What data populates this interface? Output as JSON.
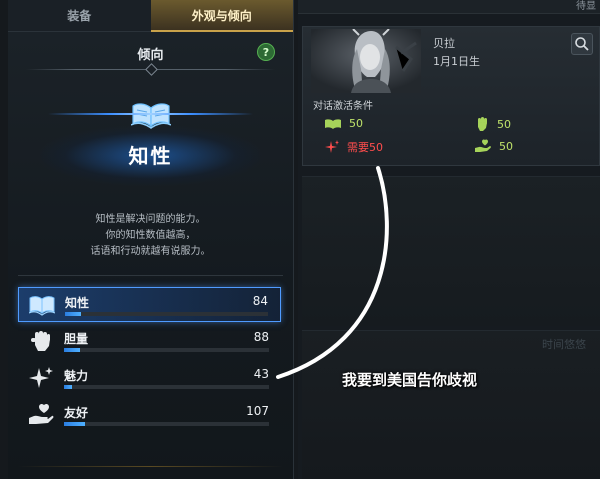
{
  "tabs": [
    {
      "label": "装备",
      "active": false
    },
    {
      "label": "外观与倾向",
      "active": true
    }
  ],
  "section": {
    "title": "倾向",
    "help_label": "?"
  },
  "hero": {
    "name": "知性",
    "icon": "open-book-icon",
    "description_lines": [
      "知性是解决问题的能力。",
      "你的知性数值越高，",
      "话语和行动就越有说服力。"
    ]
  },
  "stats": [
    {
      "label": "知性",
      "value": "84",
      "icon": "open-book-icon",
      "progress_percent": 8,
      "selected": true
    },
    {
      "label": "胆量",
      "value": "88",
      "icon": "raised-fist-icon",
      "progress_percent": 8,
      "selected": false
    },
    {
      "label": "魅力",
      "value": "43",
      "icon": "sparkle-icon",
      "progress_percent": 4,
      "selected": false
    },
    {
      "label": "友好",
      "value": "107",
      "icon": "heart-hand-icon",
      "progress_percent": 10,
      "selected": false
    }
  ],
  "npc": {
    "name": "贝拉",
    "birthday": "1月1日生",
    "conditions_title": "对话激活条件",
    "conditions": [
      {
        "icon": "open-book-icon",
        "text": "50",
        "color": "#bfe36a"
      },
      {
        "icon": "raised-fist-icon",
        "text": "50",
        "color": "#bfe36a"
      },
      {
        "icon": "sparkle-icon",
        "text": "需要50",
        "color": "#ff4d4d"
      },
      {
        "icon": "heart-hand-icon",
        "text": "50",
        "color": "#bfe36a"
      }
    ]
  },
  "top_right_label": "待显",
  "faded_label": "时间悠悠",
  "caption": "我要到美国告你歧视",
  "colors": {
    "accent_blue": "#4f9bff",
    "tab_gold": "#c9a24a",
    "condition_ok": "#bfe36a",
    "condition_fail": "#ff4d4d"
  }
}
